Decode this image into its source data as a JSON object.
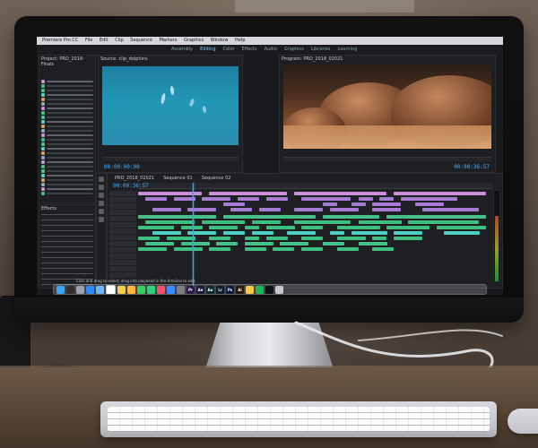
{
  "scene": {
    "subject": "iMac on desk running video editing software",
    "screen": {
      "menubar": {
        "items": [
          "Premiere Pro CC",
          "File",
          "Edit",
          "Clip",
          "Sequence",
          "Markers",
          "Graphics",
          "Window",
          "Help"
        ]
      },
      "workspace_tabs": [
        "Assembly",
        "Editing",
        "Color",
        "Effects",
        "Audio",
        "Graphics",
        "Libraries",
        "Learning"
      ],
      "active_workspace": "Editing",
      "panels": {
        "project": {
          "title": "Project: PRO_2018-Finals"
        },
        "source": {
          "title": "Source: clip_dolphins",
          "timecode": "00:00:00:00"
        },
        "program": {
          "title": "Program: PRO_2018_02021",
          "timecode": "00:00:36:57"
        },
        "effects": {
          "title": "Effects"
        },
        "timeline": {
          "sequence_tabs": [
            "PRO_2018_02021",
            "Sequence 01",
            "Sequence 02"
          ],
          "timecode": "00:00:36:57"
        }
      },
      "status": {
        "text": "Click and drag to select; drag into playhead in the timeline to edit."
      },
      "dock": {
        "apps": [
          {
            "name": "Finder",
            "color": "#3aa7ff",
            "label": ""
          },
          {
            "name": "Siri",
            "color": "#2f2f2f",
            "label": ""
          },
          {
            "name": "Launchpad",
            "color": "#9aa3ad",
            "label": ""
          },
          {
            "name": "Safari",
            "color": "#2c8cff",
            "label": ""
          },
          {
            "name": "Mail",
            "color": "#6ab8ff",
            "label": ""
          },
          {
            "name": "Calendar",
            "color": "#ffffff",
            "label": ""
          },
          {
            "name": "Notes",
            "color": "#f2d04a",
            "label": ""
          },
          {
            "name": "Photos",
            "color": "#ffb43a",
            "label": ""
          },
          {
            "name": "Messages",
            "color": "#37d05c",
            "label": ""
          },
          {
            "name": "FaceTime",
            "color": "#2fd07a",
            "label": ""
          },
          {
            "name": "Music",
            "color": "#ff4d6d",
            "label": ""
          },
          {
            "name": "App Store",
            "color": "#3a8cff",
            "label": ""
          },
          {
            "name": "System Preferences",
            "color": "#7b7f86",
            "label": ""
          },
          {
            "name": "Premiere Pro",
            "color": "#2a1a4a",
            "label": "Pr"
          },
          {
            "name": "After Effects",
            "color": "#1b1a3c",
            "label": "Ae"
          },
          {
            "name": "Audition",
            "color": "#0b2a2a",
            "label": "Au"
          },
          {
            "name": "Lightroom",
            "color": "#0b1c2e",
            "label": "Lr"
          },
          {
            "name": "Photoshop",
            "color": "#0b1e3a",
            "label": "Ps"
          },
          {
            "name": "Illustrator",
            "color": "#2a1500",
            "label": "Ai"
          },
          {
            "name": "Chrome",
            "color": "#f2c94c",
            "label": ""
          },
          {
            "name": "Spotify",
            "color": "#1db954",
            "label": ""
          },
          {
            "name": "Terminal",
            "color": "#111",
            "label": ""
          },
          {
            "name": "Trash",
            "color": "#c7c9cf",
            "label": ""
          }
        ]
      }
    }
  }
}
